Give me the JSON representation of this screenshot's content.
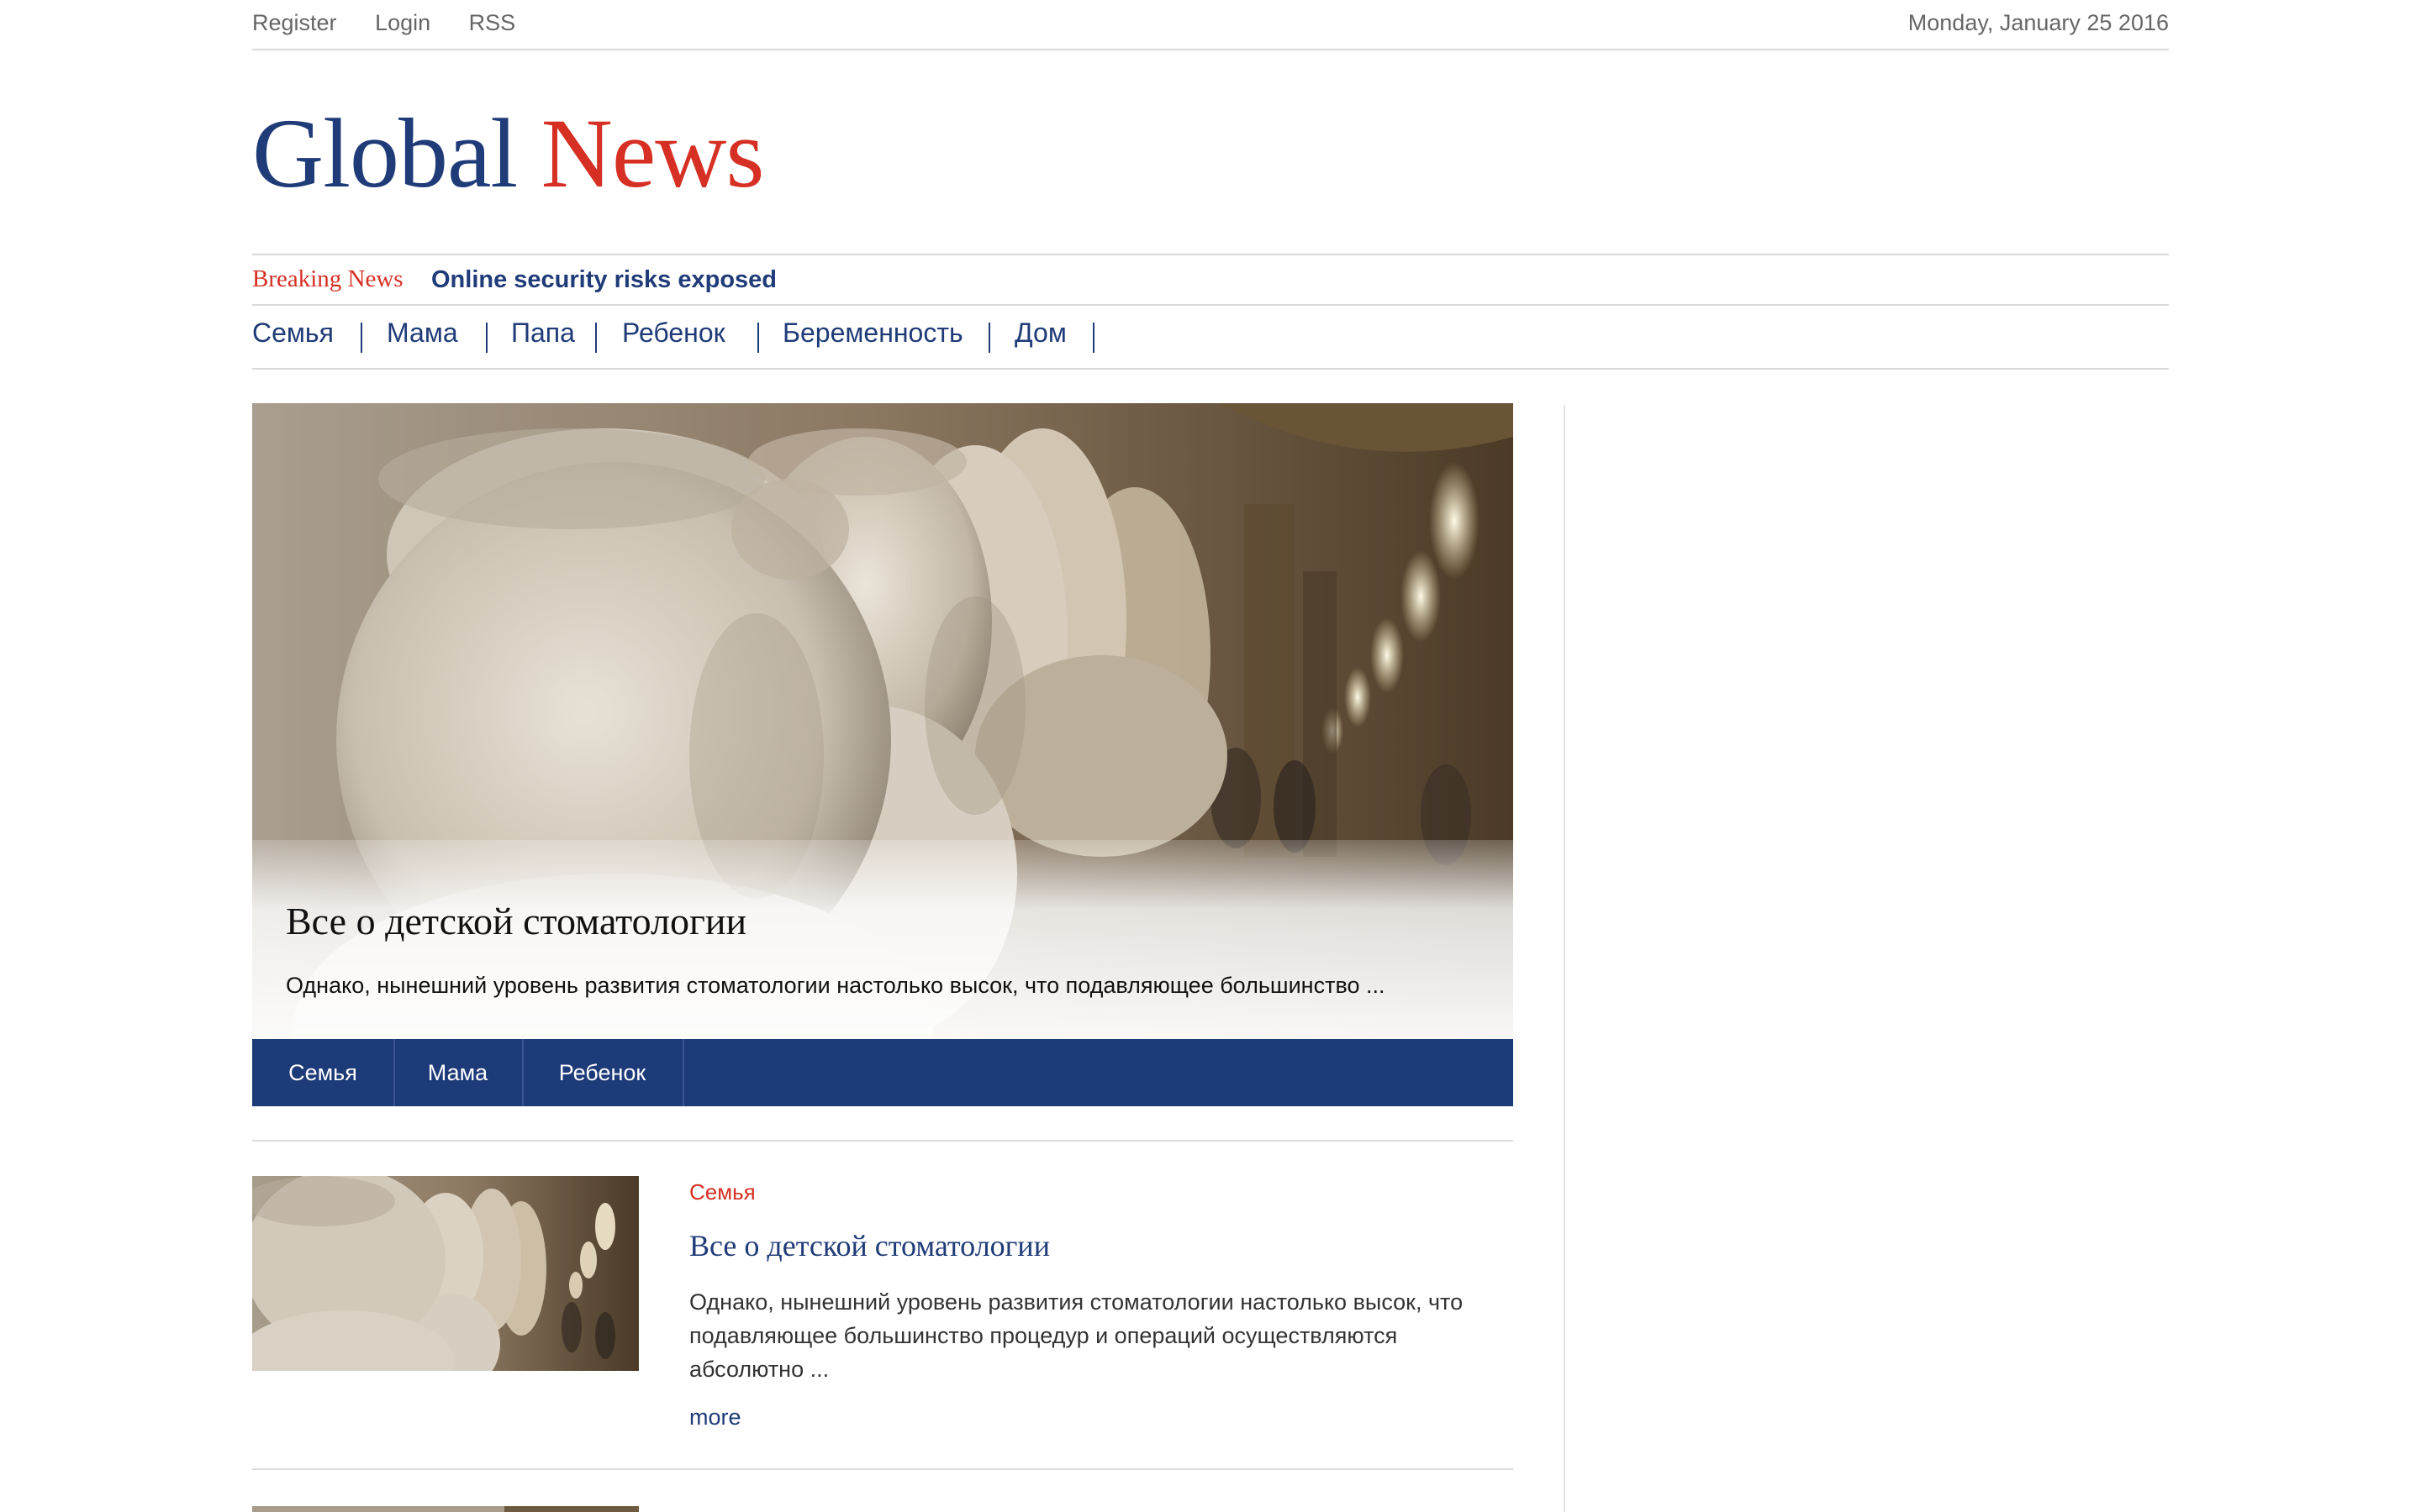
{
  "topbar": {
    "links": [
      "Register",
      "Login",
      "RSS"
    ],
    "date": "Monday, January 25 2016"
  },
  "logo": {
    "word1": "Global",
    "word2": "News"
  },
  "breaking": {
    "label": "Breaking News",
    "headline": "Online security risks exposed"
  },
  "nav": {
    "items": [
      "Семья",
      "Мама",
      "Папа",
      "Ребенок",
      "Беременность",
      "Дом"
    ]
  },
  "hero": {
    "title": "Все о детской стоматологии",
    "excerpt": "Однако, нынешний уровень развития стоматологии настолько высок, что подавляющее большинство ...",
    "tags": [
      "Семья",
      "Мама",
      "Ребенок"
    ]
  },
  "articles": [
    {
      "category": "Семья",
      "title": "Все о детской стоматологии",
      "excerpt": "Однако, нынешний уровень развития стоматологии настолько высок, что подавляющее большинство процедур и операций осуществляются абсолютно ...",
      "more": "more"
    }
  ],
  "colors": {
    "brand_blue": "#1f3b78",
    "brand_red": "#d62f23",
    "tagbar_bg": "#1d3a79"
  }
}
